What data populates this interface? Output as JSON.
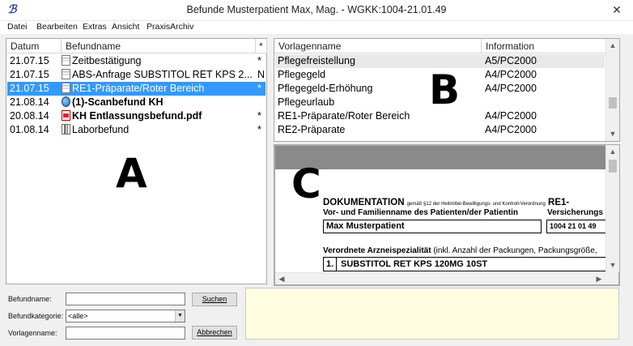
{
  "window": {
    "title": "Befunde Musterpatient Max, Mag. - WGKK:1004-21.01.49",
    "icon": "app-logo-icon",
    "close": "✕"
  },
  "menu": [
    "Datei",
    "Bearbeiten",
    "Extras",
    "Ansicht",
    "PraxisArchiv"
  ],
  "befunde": {
    "headers": {
      "datum": "Datum",
      "name": "Befundname",
      "flag": "*"
    },
    "rows": [
      {
        "date": "21.07.15",
        "name": "Zeitbestätigung",
        "flag": "*",
        "icon": "note-icon",
        "bold": false,
        "selected": false
      },
      {
        "date": "21.07.15",
        "name": "ABS-Anfrage SUBSTITOL RET KPS 2...",
        "flag": "N",
        "icon": "note-icon",
        "bold": false,
        "selected": false
      },
      {
        "date": "21.07.15",
        "name": "RE1-Präparate/Roter Bereich",
        "flag": "*",
        "icon": "note-icon",
        "bold": false,
        "selected": true
      },
      {
        "date": "21.08.14",
        "name": "(1)-Scanbefund KH",
        "flag": "",
        "icon": "scan-icon",
        "bold": true,
        "selected": false
      },
      {
        "date": "20.08.14",
        "name": "KH Entlassungsbefund.pdf",
        "flag": "*",
        "icon": "pdf-icon",
        "bold": true,
        "selected": false
      },
      {
        "date": "01.08.14",
        "name": "Laborbefund",
        "flag": "*",
        "icon": "lab-icon",
        "bold": false,
        "selected": false
      }
    ],
    "marker": "A"
  },
  "vorlagen": {
    "headers": {
      "name": "Vorlagenname",
      "info": "Information"
    },
    "rows": [
      {
        "name": "Pflegefreistellung",
        "info": "A5/PC2000",
        "highlight": true
      },
      {
        "name": "Pflegegeld",
        "info": "A4/PC2000",
        "highlight": false
      },
      {
        "name": "Pflegegeld-Erhöhung",
        "info": "A4/PC2000",
        "highlight": false
      },
      {
        "name": "Pflegeurlaub",
        "info": "",
        "highlight": false
      },
      {
        "name": "RE1-Präparate/Roter Bereich",
        "info": "A4/PC2000",
        "highlight": false
      },
      {
        "name": "RE2-Präparate",
        "info": "A4/PC2000",
        "highlight": false
      }
    ],
    "marker": "B"
  },
  "preview": {
    "marker": "C",
    "heading": "DOKUMENTATION",
    "heading_small": "gemäß §12 der Heilmittel-Bewilligungs- und Kontroll-Verordnung",
    "heading_suffix": "RE1-",
    "label_name": "Vor- und Familienname des Patienten/der Patientin",
    "label_insurance": "Versicherungs",
    "patient_name": "Max Musterpatient",
    "insurance_number": "1004 21 01 49",
    "label_drug_bold": "Verordnete Arzneispezialität",
    "label_drug_rest": " (inkl. Anzahl der Packungen, Packungsgröße,",
    "drug_index": "1.",
    "drug_name": "SUBSTITOL RET KPS 120MG 10ST"
  },
  "search": {
    "befundname_label": "Befundname:",
    "befundname_value": "",
    "kategorie_label": "Befundkategorie:",
    "kategorie_value": "<alle>",
    "vorlagenname_label": "Vorlagenname:",
    "vorlagenname_value": "",
    "search_button": "Suchen",
    "cancel_button": "Abbrechen"
  },
  "notes": {
    "text": ""
  }
}
